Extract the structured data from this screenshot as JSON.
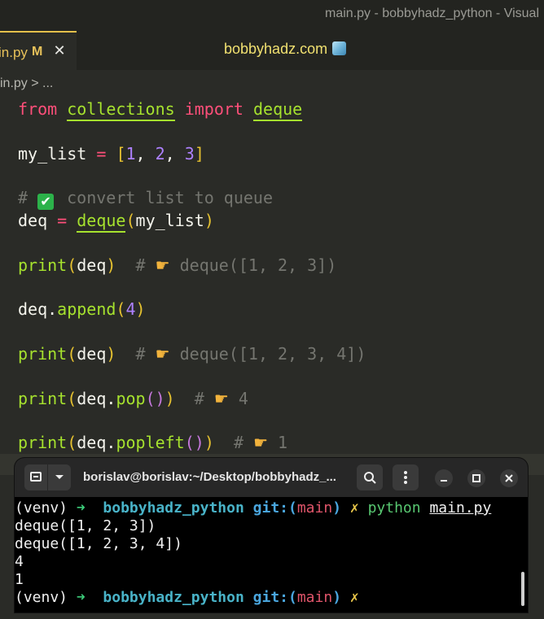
{
  "window": {
    "title": "main.py - bobbyhadz_python - Visual"
  },
  "tab": {
    "filename": "in.py",
    "modified": "M",
    "close": "✕"
  },
  "site": {
    "label": "bobbyhadz.com"
  },
  "breadcrumb": {
    "text": "in.py > ..."
  },
  "code": {
    "l1": {
      "from": "from",
      "mod": "collections",
      "imp": "import",
      "name": "deque"
    },
    "l2": {
      "var": "my_list",
      "eq": "=",
      "open": "[",
      "n1": "1",
      "c1": ", ",
      "n2": "2",
      "c2": ", ",
      "n3": "3",
      "close": "]"
    },
    "l3": {
      "hash": "#",
      "check": "✔",
      "text": "convert list to queue"
    },
    "l4": {
      "var": "deq",
      "eq": "=",
      "fn": "deque",
      "open": "(",
      "arg": "my_list",
      "close": ")"
    },
    "l5": {
      "fn": "print",
      "open": "(",
      "arg": "deq",
      "close": ")",
      "hash": "#",
      "out": "deque([1, 2, 3])"
    },
    "l6": {
      "obj": "deq.",
      "fn": "append",
      "open": "(",
      "arg": "4",
      "close": ")"
    },
    "l7": {
      "fn": "print",
      "open": "(",
      "arg": "deq",
      "close": ")",
      "hash": "#",
      "out": "deque([1, 2, 3, 4])"
    },
    "l8": {
      "fn": "print",
      "open": "(",
      "obj": "deq.",
      "fn2": "pop",
      "paren": "()",
      "close": ")",
      "hash": "#",
      "out": "4"
    },
    "l9": {
      "fn": "print",
      "open": "(",
      "obj": "deq.",
      "fn2": "popleft",
      "paren": "()",
      "close": ")",
      "hash": "#",
      "out": "1"
    }
  },
  "terminal": {
    "title": "borislav@borislav:~/Desktop/bobbyhadz_...",
    "prompt": {
      "venv": "(venv)",
      "arrow": "➜",
      "dir": "bobbyhadz_python",
      "git": "git:(",
      "branch": "main",
      "gitclose": ")",
      "dirty": "✗"
    },
    "command": {
      "cmd": "python",
      "arg": "main.py"
    },
    "output": [
      "deque([1, 2, 3])",
      "deque([1, 2, 3, 4])",
      "4",
      "1"
    ]
  },
  "colors": {
    "background": "#2a2b27",
    "keyword": "#ff4f7a",
    "function": "#a6e22e",
    "number": "#ae81ff",
    "terminal_bg": "#000000"
  }
}
